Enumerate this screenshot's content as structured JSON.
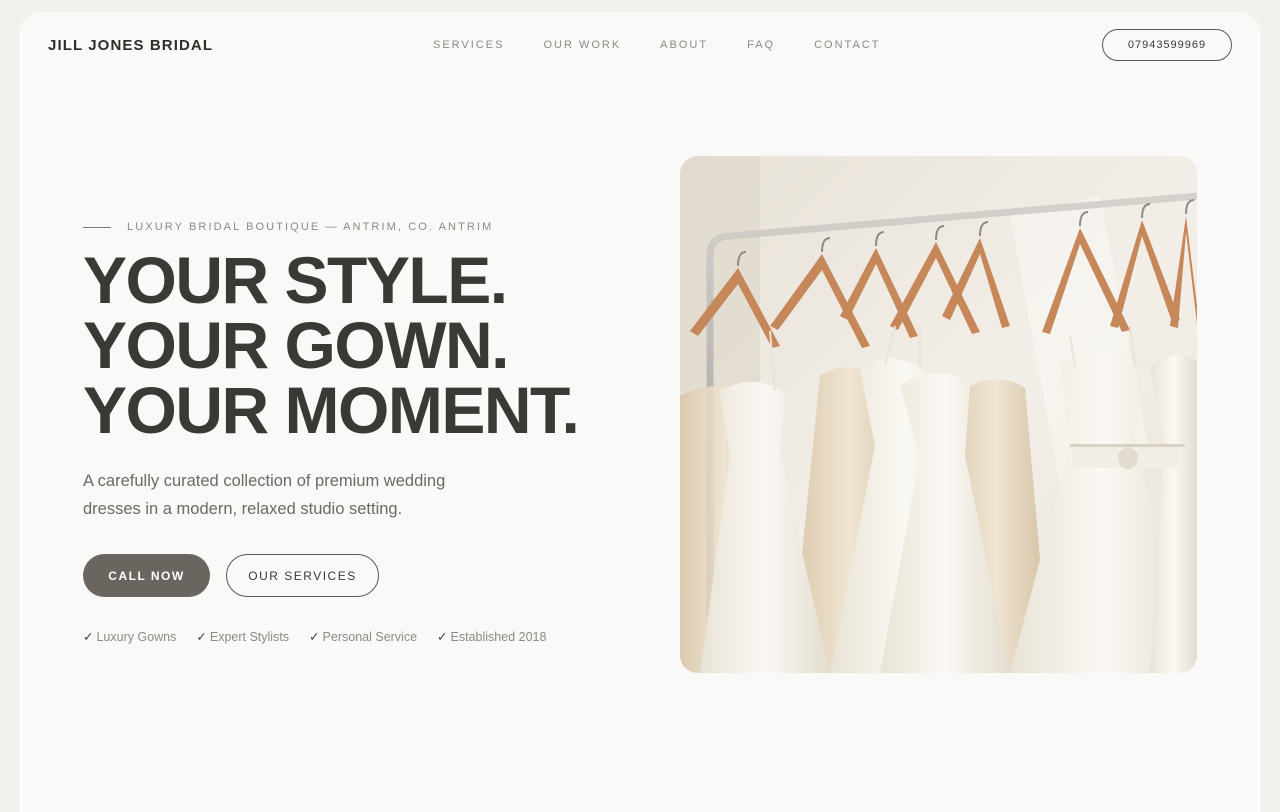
{
  "header": {
    "brand": "JILL JONES BRIDAL",
    "nav": [
      "SERVICES",
      "OUR WORK",
      "ABOUT",
      "FAQ",
      "CONTACT"
    ],
    "phone": "07943599969"
  },
  "hero": {
    "eyebrow": "LUXURY BRIDAL BOUTIQUE — ANTRIM, CO. ANTRIM",
    "headline": [
      "YOUR STYLE.",
      "YOUR GOWN.",
      "YOUR MOMENT."
    ],
    "lead": "A carefully curated collection of premium wedding dresses in a modern, relaxed studio setting.",
    "primary_cta": "CALL NOW",
    "secondary_cta": "OUR SERVICES",
    "check": "✓",
    "features": [
      "Luxury Gowns",
      "Expert Stylists",
      "Personal Service",
      "Established 2018"
    ],
    "image": "wedding dresses on wooden hangers on a rail"
  },
  "colors": {
    "page": "#f9f9f7",
    "text": "#3a3935",
    "muted": "#8c8a85",
    "button": "#6a655e"
  }
}
